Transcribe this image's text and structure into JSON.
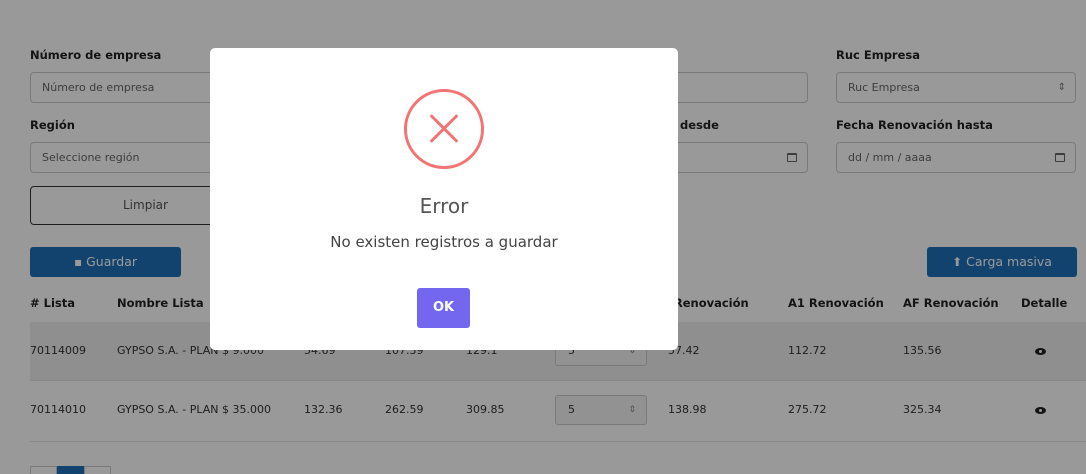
{
  "filters": {
    "numero_empresa": {
      "label": "Número de empresa",
      "placeholder": "Número de empresa"
    },
    "ruc_empresa": {
      "label": "Ruc Empresa",
      "placeholder": "Ruc Empresa"
    },
    "region": {
      "label": "Región",
      "placeholder": "Seleccione región"
    },
    "renov_desde": {
      "label_partial": "desde"
    },
    "renov_hasta": {
      "label": "Fecha Renovación hasta",
      "placeholder": "dd / mm / aaaa"
    }
  },
  "buttons": {
    "limpiar": "Limpiar",
    "guardar": "Guardar",
    "carga_masiva": "Carga masiva"
  },
  "table": {
    "headers": {
      "lista": "# Lista",
      "nombre": "Nombre Lista",
      "t_renov": "T Renovación",
      "a1_renov": "A1 Renovación",
      "af_renov": "AF Renovación",
      "detalle": "Detalle"
    },
    "rows": [
      {
        "lista": "70114009",
        "nombre": "GYPSO S.A. - PLAN $ 9.000",
        "c1": "54.69",
        "c2": "107.39",
        "c3": "129.1",
        "qty": "5",
        "t": "57.42",
        "a1": "112.72",
        "af": "135.56"
      },
      {
        "lista": "70114010",
        "nombre": "GYPSO S.A. - PLAN $ 35.000",
        "c1": "132.36",
        "c2": "262.59",
        "c3": "309.85",
        "qty": "5",
        "t": "138.98",
        "a1": "275.72",
        "af": "325.34"
      }
    ]
  },
  "modal": {
    "title": "Error",
    "text": "No existen registros a guardar",
    "ok": "OK",
    "icon": "error-x-icon",
    "icon_color": "#f27474",
    "ok_color": "#7367f0"
  },
  "colors": {
    "primary": "#1e6fb8",
    "overlay": "rgba(0,0,0,0.40)"
  }
}
